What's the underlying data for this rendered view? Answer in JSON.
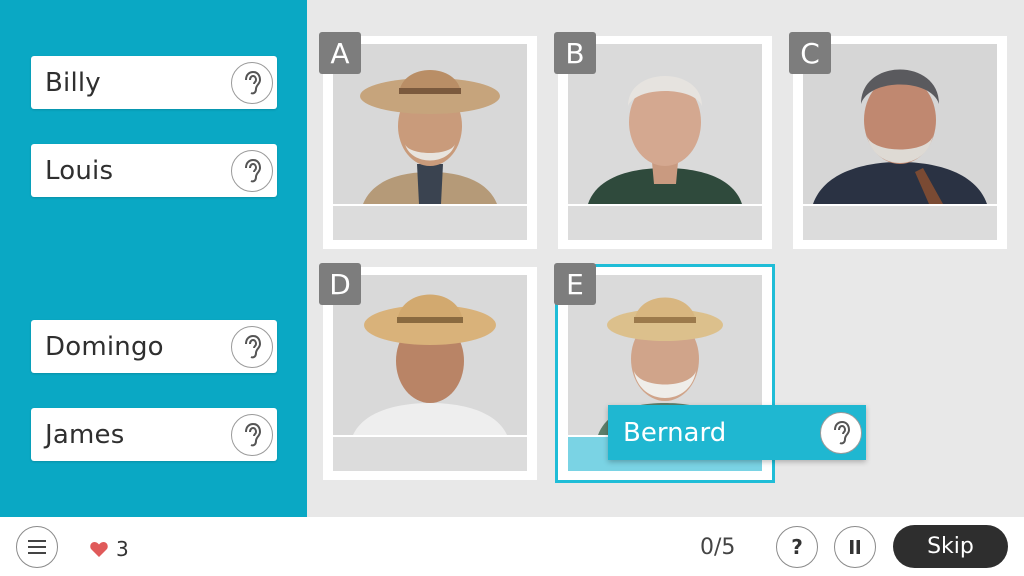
{
  "names": [
    {
      "label": "Billy",
      "icon": "ear-icon"
    },
    {
      "label": "Louis",
      "icon": "ear-icon"
    },
    {
      "label": "Domingo",
      "icon": "ear-icon"
    },
    {
      "label": "James",
      "icon": "ear-icon"
    }
  ],
  "dragging": {
    "label": "Bernard",
    "icon": "ear-icon"
  },
  "cards": [
    {
      "letter": "A",
      "answer": ""
    },
    {
      "letter": "B",
      "answer": ""
    },
    {
      "letter": "C",
      "answer": ""
    },
    {
      "letter": "D",
      "answer": ""
    },
    {
      "letter": "E",
      "answer": ""
    }
  ],
  "footer": {
    "menu_icon": "hamburger-menu-icon",
    "lives_icon": "heart-icon",
    "lives": "3",
    "progress": "0/5",
    "help_label": "?",
    "pause_icon": "pause-icon",
    "skip_label": "Skip"
  },
  "colors": {
    "sidebar": "#0aa8c4",
    "accent": "#1fb7d1",
    "heart": "#e05a5a",
    "skip_bg": "#2e2e2e"
  }
}
